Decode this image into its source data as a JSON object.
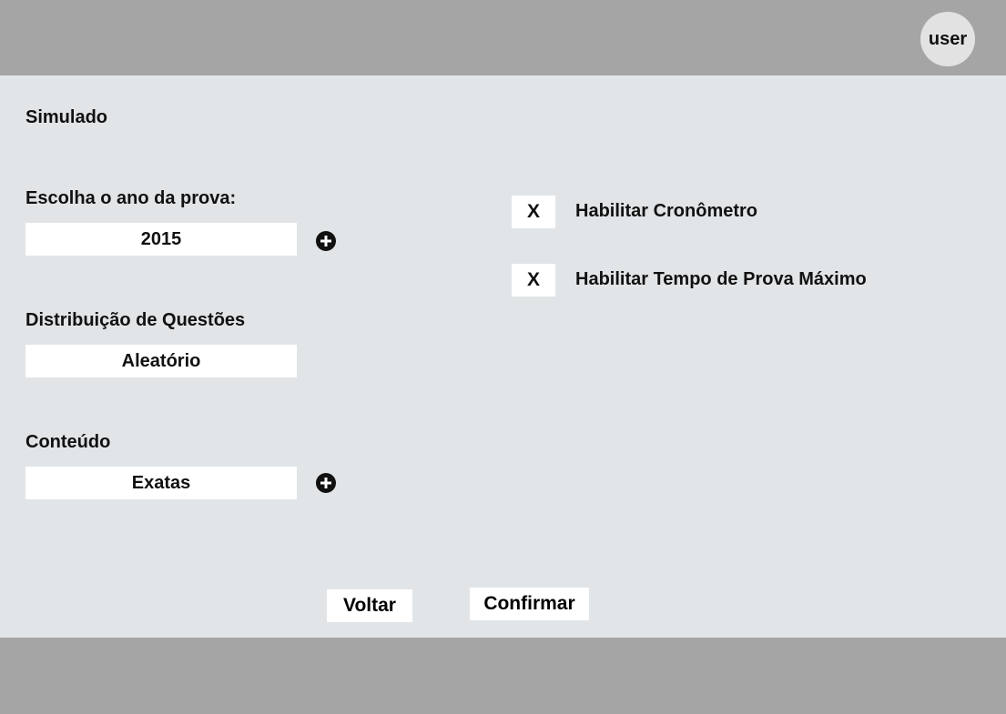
{
  "header": {
    "user_label": "user"
  },
  "main": {
    "page_title": "Simulado",
    "year": {
      "label": "Escolha o ano da prova:",
      "value": "2015"
    },
    "distribution": {
      "label": "Distribuição de Questões",
      "value": "Aleatório"
    },
    "content": {
      "label": "Conteúdo",
      "value": "Exatas"
    },
    "options": [
      {
        "mark": "X",
        "label": "Habilitar Cronômetro"
      },
      {
        "mark": "X",
        "label": "Habilitar Tempo de Prova Máximo"
      }
    ],
    "buttons": {
      "back_label": "Voltar",
      "confirm_label": "Confirmar"
    }
  },
  "colors": {
    "header_bg": "#a5a5a5",
    "main_bg": "#e2e5e7",
    "field_bg": "#ffffff"
  },
  "icons": {
    "add": "plus-circle-icon"
  }
}
